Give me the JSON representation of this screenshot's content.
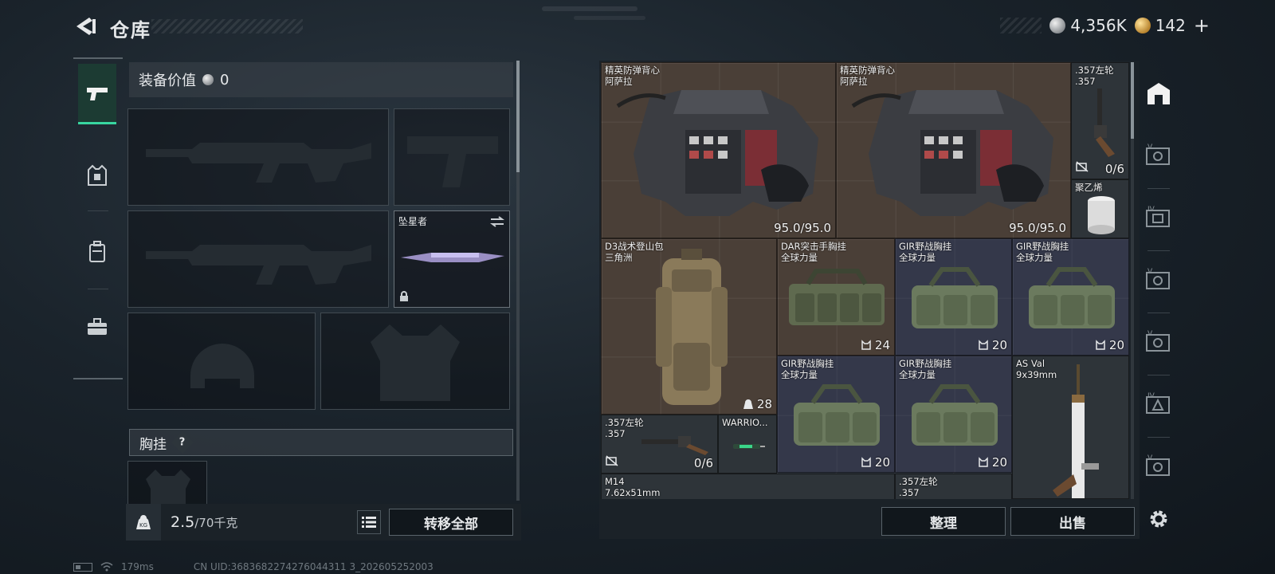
{
  "header": {
    "title": "仓库",
    "currency_silver": "4,356K",
    "currency_gold": "142",
    "plus": "+"
  },
  "equipment": {
    "value_label": "装备价值",
    "value": "0",
    "melee_label": "坠星者",
    "section_chest_rig": "胸挂",
    "help": "?"
  },
  "weight": {
    "current": "2.5",
    "max": "/70千克",
    "transfer_all": "转移全部"
  },
  "storage": {
    "items": [
      {
        "name": "精英防弹背心",
        "sub": "阿萨拉",
        "value": "95.0/95.0"
      },
      {
        "name": "精英防弹背心",
        "sub": "阿萨拉",
        "value": "95.0/95.0"
      },
      {
        "name": ".357左轮",
        "sub": ".357",
        "value": "0/6"
      },
      {
        "name": "聚乙烯",
        "sub": "",
        "value": ""
      },
      {
        "name": "D3战术登山包",
        "sub": "三角洲",
        "value": "28"
      },
      {
        "name": "DAR突击手胸挂",
        "sub": "全球力量",
        "value": "24"
      },
      {
        "name": "GIR野战胸挂",
        "sub": "全球力量",
        "value": "20"
      },
      {
        "name": "GIR野战胸挂",
        "sub": "全球力量",
        "value": "20"
      },
      {
        "name": "GIR野战胸挂",
        "sub": "全球力量",
        "value": "20"
      },
      {
        "name": "GIR野战胸挂",
        "sub": "全球力量",
        "value": "20"
      },
      {
        "name": "AS Val",
        "sub": "9x39mm",
        "value": ""
      },
      {
        "name": ".357左轮",
        "sub": ".357",
        "value": "0/6"
      },
      {
        "name": "WARRIO...",
        "sub": "",
        "value": ""
      },
      {
        "name": "M14",
        "sub": "7.62x51mm",
        "value": ""
      },
      {
        "name": ".357左轮",
        "sub": ".357",
        "value": ""
      }
    ],
    "sort_button": "整理",
    "sell_button": "出售"
  },
  "status_bar": {
    "ping": "179ms",
    "uid": "CN UID:3683682274276044311 3_202605252003"
  },
  "colors": {
    "accent_green": "#38d6a0",
    "item_brown": "#4a3f37",
    "item_blue": "#34384a"
  }
}
